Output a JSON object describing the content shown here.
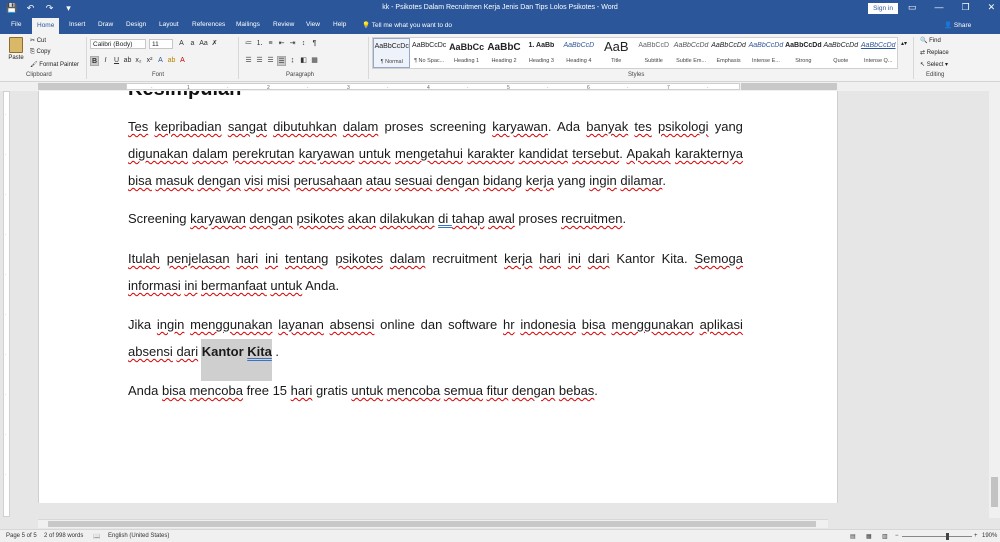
{
  "titlebar": {
    "title": "kk - Psikotes Dalam Recruitmen Kerja Jenis Dan Tips Lolos Psikotes - Word",
    "signin": "Sign in",
    "qat": [
      "💾",
      "↶",
      "↷",
      "▾"
    ],
    "win_min": "—",
    "win_restore": "❐",
    "win_close": "✕",
    "ribbon_display": "▭"
  },
  "tabs": [
    "File",
    "Home",
    "Insert",
    "Draw",
    "Design",
    "Layout",
    "References",
    "Mailings",
    "Review",
    "View",
    "Help"
  ],
  "tell_me": "Tell me what you want to do",
  "share": "Share",
  "clipboard": {
    "paste": "Paste",
    "cut": "Cut",
    "copy": "Copy",
    "format_painter": "Format Painter",
    "label": "Clipboard"
  },
  "font": {
    "name": "Calibri (Body)",
    "size": "11",
    "label": "Font"
  },
  "paragraph": {
    "label": "Paragraph"
  },
  "styles": {
    "label": "Styles",
    "items": [
      {
        "sample": "AaBbCcDc",
        "name": "¶ Normal"
      },
      {
        "sample": "AaBbCcDc",
        "name": "¶ No Spac..."
      },
      {
        "sample": "AaBbCc",
        "name": "Heading 1"
      },
      {
        "sample": "AaBbC",
        "name": "Heading 2"
      },
      {
        "sample": "1. AaBb",
        "name": "Heading 3"
      },
      {
        "sample": "AaBbCcD",
        "name": "Heading 4"
      },
      {
        "sample": "AaB",
        "name": "Title"
      },
      {
        "sample": "AaBbCcD",
        "name": "Subtitle"
      },
      {
        "sample": "AaBbCcDd",
        "name": "Subtle Em..."
      },
      {
        "sample": "AaBbCcDd",
        "name": "Emphasis"
      },
      {
        "sample": "AaBbCcDd",
        "name": "Intense E..."
      },
      {
        "sample": "AaBbCcDd",
        "name": "Strong"
      },
      {
        "sample": "AaBbCcDd",
        "name": "Quote"
      },
      {
        "sample": "AaBbCcDd",
        "name": "Intense Q..."
      }
    ]
  },
  "editing": {
    "find": "Find",
    "replace": "Replace",
    "select": "Select",
    "label": "Editing"
  },
  "document": {
    "heading_fragment": "Kesimpulan",
    "p1": [
      {
        "t": " "
      },
      {
        "t": "Tes",
        "s": 1
      },
      {
        "t": " "
      },
      {
        "t": "kepribadian",
        "s": 1
      },
      {
        "t": " "
      },
      {
        "t": "sangat",
        "s": 1
      },
      {
        "t": " "
      },
      {
        "t": "dibutuhkan",
        "s": 1
      },
      {
        "t": " "
      },
      {
        "t": "dalam",
        "s": 1
      },
      {
        "t": " proses screening "
      },
      {
        "t": "karyawan",
        "s": 1
      },
      {
        "t": ". Ada "
      },
      {
        "t": "banyak",
        "s": 1
      },
      {
        "t": " "
      },
      {
        "t": "tes",
        "s": 1
      },
      {
        "t": " "
      },
      {
        "t": "psikologi",
        "s": 1
      },
      {
        "t": " yang "
      },
      {
        "t": "digunakan",
        "s": 1
      },
      {
        "t": " "
      },
      {
        "t": "dalam",
        "s": 1
      },
      {
        "t": " "
      },
      {
        "t": "perekrutan",
        "s": 1
      },
      {
        "t": " "
      },
      {
        "t": "karyawan",
        "s": 1
      },
      {
        "t": " "
      },
      {
        "t": "untuk",
        "s": 1
      },
      {
        "t": " "
      },
      {
        "t": "mengetahui",
        "s": 1
      },
      {
        "t": " "
      },
      {
        "t": "karakter",
        "s": 1
      },
      {
        "t": " "
      },
      {
        "t": "kandidat",
        "s": 1
      },
      {
        "t": " "
      },
      {
        "t": "tersebut",
        "s": 1
      },
      {
        "t": ". "
      },
      {
        "t": "Apakah",
        "s": 1
      },
      {
        "t": " "
      },
      {
        "t": "karakternya",
        "s": 1
      },
      {
        "t": " "
      },
      {
        "t": "bisa",
        "s": 1
      },
      {
        "t": " "
      },
      {
        "t": "masuk",
        "s": 1
      },
      {
        "t": " "
      },
      {
        "t": "dengan",
        "s": 1
      },
      {
        "t": " "
      },
      {
        "t": "visi",
        "s": 1
      },
      {
        "t": " "
      },
      {
        "t": "misi",
        "s": 1
      },
      {
        "t": " "
      },
      {
        "t": "perusahaan",
        "s": 1
      },
      {
        "t": " "
      },
      {
        "t": "atau",
        "s": 1
      },
      {
        "t": " "
      },
      {
        "t": "sesuai",
        "s": 1
      },
      {
        "t": " "
      },
      {
        "t": "dengan",
        "s": 1
      },
      {
        "t": " "
      },
      {
        "t": "bidang",
        "s": 1
      },
      {
        "t": " "
      },
      {
        "t": "kerja",
        "s": 1
      },
      {
        "t": " yang "
      },
      {
        "t": "ingin",
        "s": 1
      },
      {
        "t": " "
      },
      {
        "t": "dilamar",
        "s": 1
      },
      {
        "t": "."
      }
    ],
    "p2": [
      {
        "t": "Screening "
      },
      {
        "t": "karyawan",
        "s": 1
      },
      {
        "t": " "
      },
      {
        "t": "dengan",
        "s": 1
      },
      {
        "t": " "
      },
      {
        "t": "psikotes",
        "s": 1
      },
      {
        "t": " "
      },
      {
        "t": "akan",
        "s": 1
      },
      {
        "t": " "
      },
      {
        "t": "dilakukan",
        "s": 1
      },
      {
        "t": " "
      },
      {
        "t": "di ",
        "s": 2
      },
      {
        "t": " "
      },
      {
        "t": "tahap",
        "s": 1
      },
      {
        "t": " "
      },
      {
        "t": "awal",
        "s": 1
      },
      {
        "t": " proses "
      },
      {
        "t": "recruitmen",
        "s": 1
      },
      {
        "t": "."
      }
    ],
    "p3": [
      {
        "t": "Itulah",
        "s": 1
      },
      {
        "t": " "
      },
      {
        "t": "penjelasan",
        "s": 1
      },
      {
        "t": " "
      },
      {
        "t": "hari",
        "s": 1
      },
      {
        "t": " "
      },
      {
        "t": "ini",
        "s": 1
      },
      {
        "t": " "
      },
      {
        "t": "tentang",
        "s": 1
      },
      {
        "t": " "
      },
      {
        "t": "psikotes",
        "s": 1
      },
      {
        "t": " "
      },
      {
        "t": "dalam",
        "s": 1
      },
      {
        "t": " recruitment "
      },
      {
        "t": "kerja",
        "s": 1
      },
      {
        "t": " "
      },
      {
        "t": "hari",
        "s": 1
      },
      {
        "t": " "
      },
      {
        "t": "ini",
        "s": 1
      },
      {
        "t": " "
      },
      {
        "t": "dari",
        "s": 1
      },
      {
        "t": " Kantor Kita. "
      },
      {
        "t": "Semoga",
        "s": 1
      },
      {
        "t": " "
      },
      {
        "t": "informasi",
        "s": 1
      },
      {
        "t": " "
      },
      {
        "t": "ini",
        "s": 1
      },
      {
        "t": " "
      },
      {
        "t": "bermanfaat",
        "s": 1
      },
      {
        "t": " "
      },
      {
        "t": "untuk",
        "s": 1
      },
      {
        "t": " Anda."
      }
    ],
    "p4": [
      {
        "t": "Jika "
      },
      {
        "t": "ingin",
        "s": 1
      },
      {
        "t": " "
      },
      {
        "t": "menggunakan",
        "s": 1
      },
      {
        "t": " "
      },
      {
        "t": "layanan",
        "s": 1
      },
      {
        "t": " "
      },
      {
        "t": "absensi",
        "s": 1
      },
      {
        "t": " online dan software "
      },
      {
        "t": "hr",
        "s": 1
      },
      {
        "t": " "
      },
      {
        "t": "indonesia",
        "s": 1
      },
      {
        "t": " "
      },
      {
        "t": "bisa",
        "s": 1
      },
      {
        "t": " "
      },
      {
        "t": "menggunakan",
        "s": 1
      },
      {
        "t": " "
      },
      {
        "t": "aplikasi",
        "s": 1
      },
      {
        "t": " "
      },
      {
        "t": "absensi",
        "s": 1
      },
      {
        "t": " "
      },
      {
        "t": "dari",
        "s": 1
      },
      {
        "t": " "
      },
      {
        "t": "Kantor ",
        "b": 1
      },
      {
        "t": "Kita",
        "b": 1,
        "s": 2
      },
      {
        "t": " ."
      }
    ],
    "p5": [
      {
        "t": "Anda "
      },
      {
        "t": "bisa",
        "s": 1
      },
      {
        "t": " "
      },
      {
        "t": "mencoba",
        "s": 1
      },
      {
        "t": " free 15 "
      },
      {
        "t": "hari",
        "s": 1
      },
      {
        "t": " gratis "
      },
      {
        "t": "untuk",
        "s": 1
      },
      {
        "t": " "
      },
      {
        "t": "mencoba",
        "s": 1
      },
      {
        "t": " "
      },
      {
        "t": "semua",
        "s": 1
      },
      {
        "t": " "
      },
      {
        "t": "fitur",
        "s": 1
      },
      {
        "t": " "
      },
      {
        "t": "dengan",
        "s": 1
      },
      {
        "t": " "
      },
      {
        "t": "bebas",
        "s": 1
      },
      {
        "t": "."
      }
    ]
  },
  "status": {
    "page": "Page 5 of 5",
    "words": "2 of 998 words",
    "language": "English (United States)",
    "zoom": "190%"
  }
}
